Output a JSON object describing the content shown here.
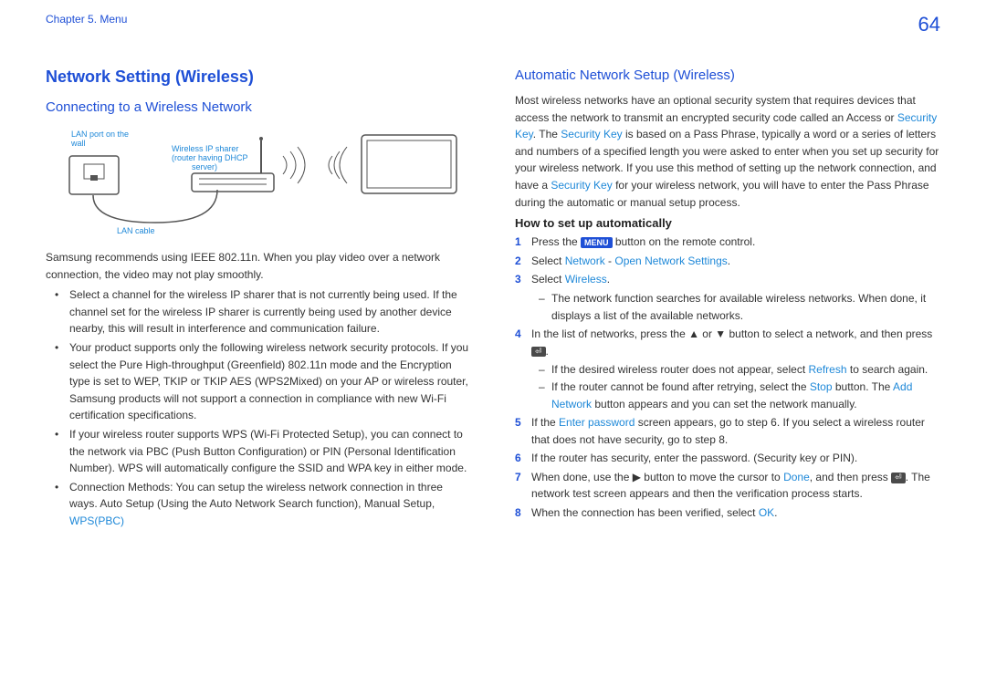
{
  "header": {
    "chapter": "Chapter 5. Menu",
    "page_number": "64"
  },
  "left": {
    "title": "Network Setting (Wireless)",
    "subtitle": "Connecting to a Wireless Network",
    "diagram": {
      "lan_port": "LAN port on the wall",
      "ip_sharer": "Wireless IP sharer (router having DHCP server)",
      "lan_cable": "LAN cable"
    },
    "intro1": "Samsung recommends using IEEE 802.11n. When you play video over a network connection, the video may not play smoothly.",
    "bullets": [
      "Select a channel for the wireless IP sharer that is not currently being used. If the channel set for the wireless IP sharer is currently being used by another device nearby, this will result in interference and communication failure.",
      "Your product supports only the following wireless network security protocols. If you select the Pure High-throughput (Greenfield) 802.11n mode and the Encryption type is set to WEP, TKIP or TKIP AES (WPS2Mixed) on your AP or wireless router, Samsung products will not support a connection in compliance with new Wi-Fi certification specifications.",
      "If your wireless router supports WPS (Wi-Fi Protected Setup), you can connect to the network via PBC (Push Button Configuration) or PIN (Personal Identification Number). WPS will automatically configure the SSID and WPA key in either mode."
    ],
    "bullet4_pre": "Connection Methods: You can setup the wireless network connection in three ways. Auto Setup (Using the Auto Network Search function), Manual Setup, ",
    "wps_link": "WPS(PBC)"
  },
  "right": {
    "subtitle": "Automatic Network Setup (Wireless)",
    "p1a": "Most wireless networks have an optional security system that requires devices that access the network to transmit an encrypted security code called an Access or ",
    "security_key": "Security Key",
    "p1b": ". The ",
    "p1c": " is based on a Pass Phrase, typically a word or a series of letters and numbers of a specified length you were asked to enter when you set up security for your wireless network. If you use this method of setting up the network connection, and have a ",
    "p1d": " for your wireless network, you will have to enter the Pass Phrase during the automatic or manual setup process.",
    "howto_title": "How to set up automatically",
    "step1_a": "Press the ",
    "menu_label": "MENU",
    "step1_b": " button on the remote control.",
    "step2_a": "Select ",
    "step2_network": "Network",
    "step2_dash": " - ",
    "step2_open": "Open Network Settings",
    "step2_end": ".",
    "step3_a": "Select ",
    "step3_wireless": "Wireless",
    "step3_end": ".",
    "step3_dash1": "The network function searches for available wireless networks. When done, it displays a list of the available networks.",
    "step4_a": "In the list of networks, press the ▲ or ▼ button to select a network, and then press ",
    "step4_icon": "⏎",
    "step4_end": ".",
    "step4_dash1_a": "If the desired wireless router does not appear, select ",
    "refresh": "Refresh",
    "step4_dash1_b": " to search again.",
    "step4_dash2_a": "If the router cannot be found after retrying, select the ",
    "stop": "Stop",
    "step4_dash2_b": " button. The ",
    "add_network": "Add Network",
    "step4_dash2_c": " button appears and you can set the network manually.",
    "step5_a": "If the ",
    "enter_password": "Enter password",
    "step5_b": " screen appears, go to step 6. If you select a wireless router that does not have security, go to step 8.",
    "step6": "If the router has security, enter the password. (Security key or PIN).",
    "step7_a": "When done, use the ▶ button to move the cursor to ",
    "done": "Done",
    "step7_b": ", and then press ",
    "step7_icon": "⏎",
    "step7_c": ". The network test screen appears and then the verification process starts.",
    "step8_a": "When the connection has been verified, select ",
    "ok": "OK",
    "step8_b": "."
  }
}
